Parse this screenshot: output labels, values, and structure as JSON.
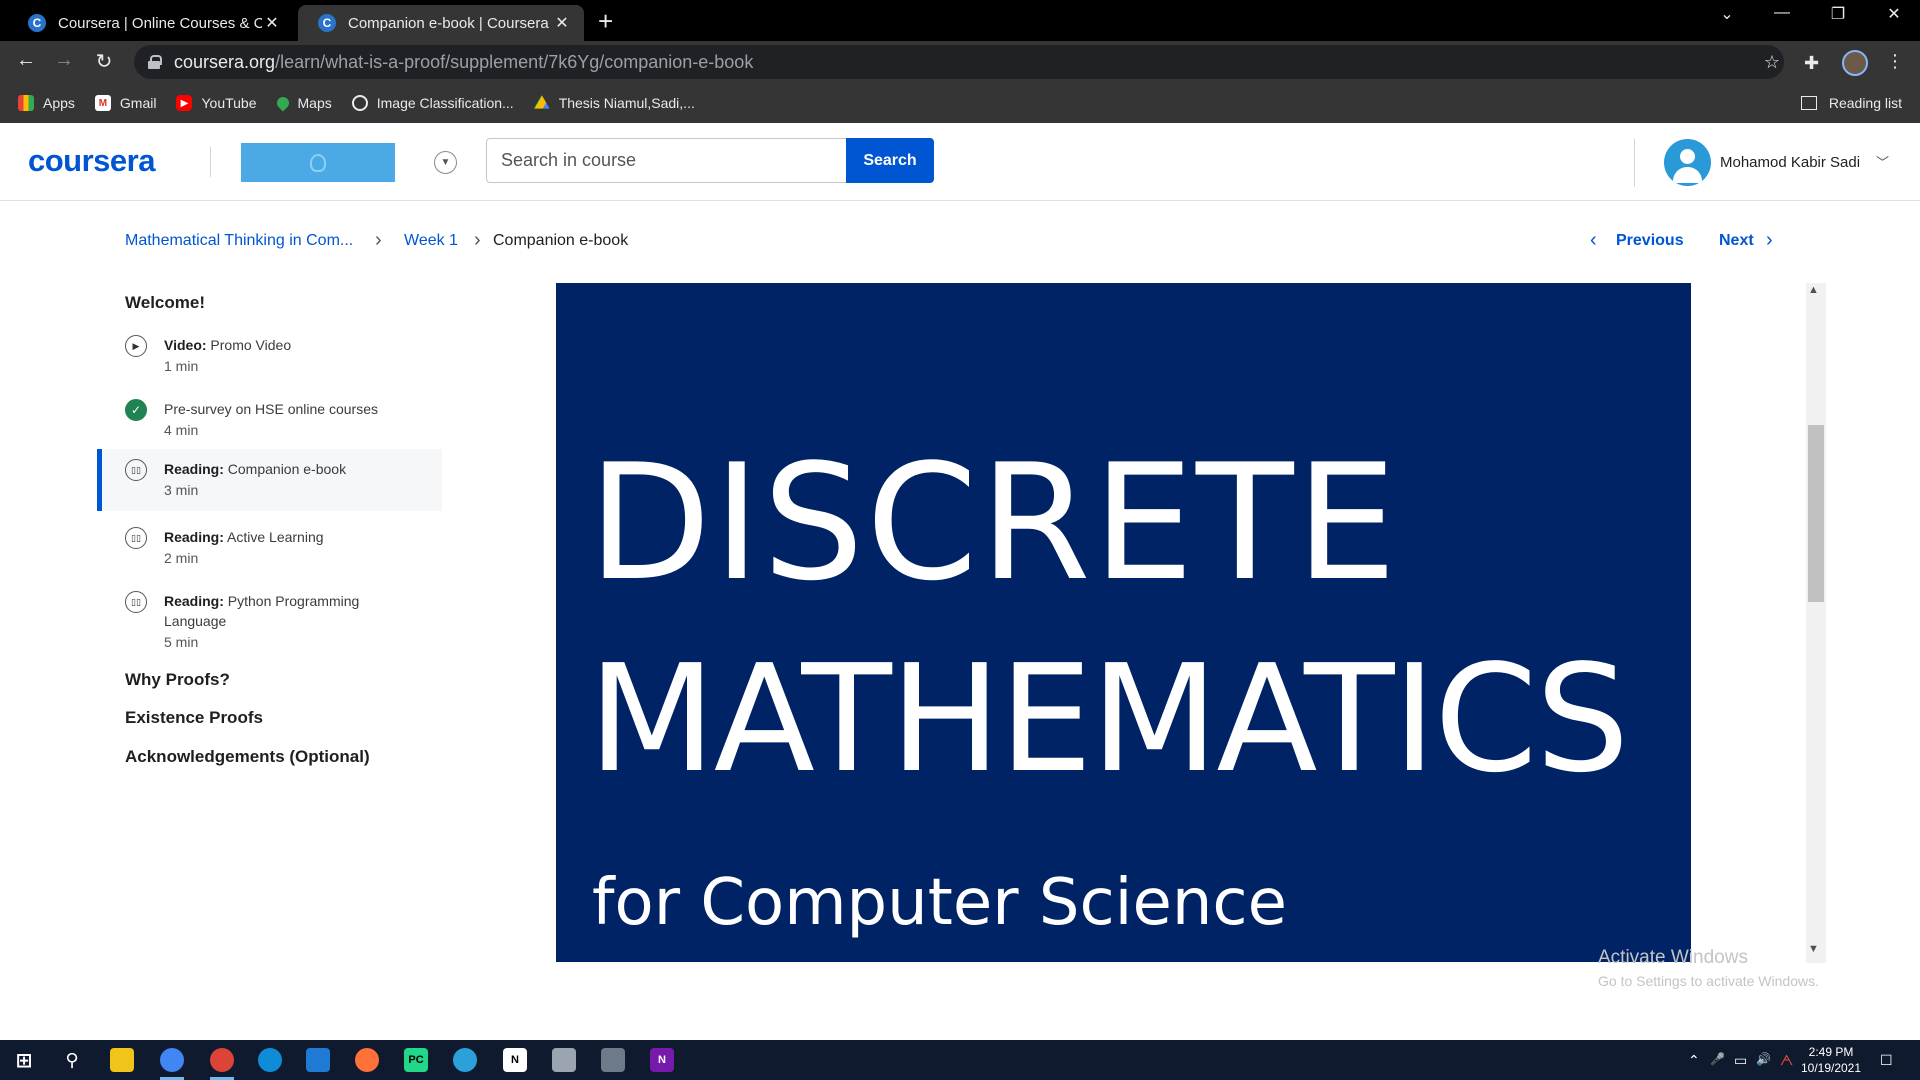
{
  "browser": {
    "tabs": [
      {
        "title": "Coursera | Online Courses & Credentials",
        "favicon": "C"
      },
      {
        "title": "Companion e-book | Coursera",
        "favicon": "C"
      }
    ],
    "new_tab": "+",
    "window_controls": {
      "chevron": "⌄",
      "minimize": "—",
      "restore": "❐",
      "close": "✕"
    },
    "nav": {
      "back": "←",
      "forward": "→",
      "reload": "↻"
    },
    "url_host": "coursera.org",
    "url_path": "/learn/what-is-a-proof/supplement/7k6Yg/companion-e-book",
    "star": "☆",
    "extensions": "✚",
    "menu": "⋮",
    "bookmarks": [
      {
        "label": "Apps",
        "icon": "apps-grid-icon",
        "color": "#ea4335"
      },
      {
        "label": "Gmail",
        "icon": "gmail-icon",
        "color": "#d93025"
      },
      {
        "label": "YouTube",
        "icon": "youtube-icon",
        "color": "#ff0000"
      },
      {
        "label": "Maps",
        "icon": "maps-pin-icon",
        "color": "#34a853"
      },
      {
        "label": "Image Classification...",
        "icon": "globe-icon",
        "color": "#5f6368"
      },
      {
        "label": "Thesis Niamul,Sadi,...",
        "icon": "drive-icon",
        "color": "#fbbc04"
      }
    ],
    "reading_list": "Reading list"
  },
  "header": {
    "logo": "coursera",
    "search_placeholder": "Search in course",
    "search_button": "Search",
    "username": "Mohamod Kabir Sadi",
    "user_chevron": "﹀"
  },
  "breadcrumb": {
    "course": "Mathematical Thinking in Com...",
    "week": "Week 1",
    "current": "Companion e-book",
    "sep": "›"
  },
  "pager": {
    "previous": "Previous",
    "next": "Next",
    "prev_arrow": "‹",
    "next_arrow": "›"
  },
  "sidebar": {
    "section_welcome": "Welcome!",
    "items": [
      {
        "kind": "Video:",
        "title": "Promo Video",
        "duration": "1 min",
        "icon": "play-icon",
        "glyph": "▶"
      },
      {
        "kind": "",
        "title": "Pre-survey on HSE online courses",
        "duration": "4 min",
        "icon": "check-icon",
        "glyph": "✓"
      },
      {
        "kind": "Reading:",
        "title": "Companion e-book",
        "duration": "3 min",
        "icon": "book-icon",
        "glyph": "▯▯"
      },
      {
        "kind": "Reading:",
        "title": "Active Learning",
        "duration": "2 min",
        "icon": "book-icon",
        "glyph": "▯▯"
      },
      {
        "kind": "Reading:",
        "title": "Python Programming Language",
        "duration": "5 min",
        "icon": "book-icon",
        "glyph": "▯▯"
      }
    ],
    "sections": [
      "Why Proofs?",
      "Existence Proofs",
      "Acknowledgements (Optional)"
    ]
  },
  "content": {
    "cover_line1": "DISCRETE",
    "cover_line2": "MATHEMATICS",
    "cover_line3": "for Computer Science",
    "cover_color": "#002366"
  },
  "scrollbar": {
    "up": "▲",
    "down": "▼"
  },
  "watermark": {
    "line1": "Activate Windows",
    "line2": "Go to Settings to activate Windows."
  },
  "taskbar": {
    "apps": [
      {
        "name": "windows-start-icon",
        "glyph": "⊞",
        "color": "transparent"
      },
      {
        "name": "search-icon",
        "glyph": "⚲",
        "color": "transparent"
      },
      {
        "name": "file-explorer-icon",
        "glyph": "",
        "color": "#f0c419"
      },
      {
        "name": "chrome-icon",
        "glyph": "",
        "color": "#4285f4"
      },
      {
        "name": "chrome-profile-icon",
        "glyph": "",
        "color": "#db4437"
      },
      {
        "name": "edge-icon",
        "glyph": "",
        "color": "#0f8cd8"
      },
      {
        "name": "vscode-icon",
        "glyph": "",
        "color": "#1f7ad3"
      },
      {
        "name": "firefox-icon",
        "glyph": "",
        "color": "#ff7139"
      },
      {
        "name": "pycharm-icon",
        "glyph": "PC",
        "color": "#21d789"
      },
      {
        "name": "telegram-icon",
        "glyph": "",
        "color": "#2aa1da"
      },
      {
        "name": "notion-icon",
        "glyph": "N",
        "color": "#ffffff"
      },
      {
        "name": "screen-icon",
        "glyph": "",
        "color": "#9aa5b1"
      },
      {
        "name": "calculator-icon",
        "glyph": "",
        "color": "#6c7a89"
      },
      {
        "name": "onenote-icon",
        "glyph": "N",
        "color": "#7719aa"
      }
    ],
    "tray": {
      "chevron": "⌃",
      "mic": "🎤",
      "network": "▭",
      "volume": "🔊",
      "lang": "ᗅ",
      "notifications": "☐"
    },
    "time": "2:49 PM",
    "date": "10/19/2021"
  }
}
